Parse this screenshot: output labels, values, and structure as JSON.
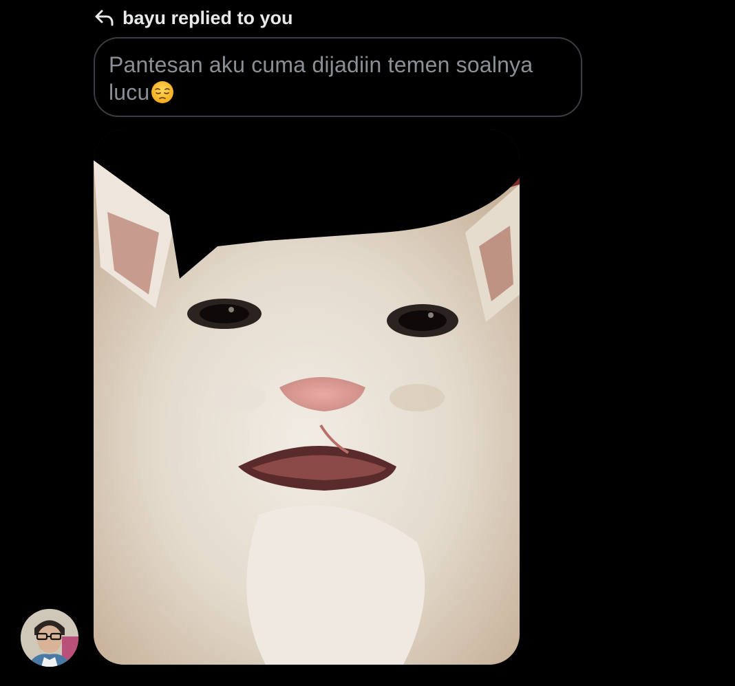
{
  "reply_header": {
    "icon": "reply-arrow-icon",
    "text": "bayu replied to you"
  },
  "quoted_message": {
    "text": "Pantesan aku cuma dijadiin temen soalnya lucu",
    "emoji": "pensive-face-emoji"
  },
  "media": {
    "kind": "image",
    "subject": "cat-meme-image"
  },
  "sender": {
    "avatar": "avatar"
  },
  "colors": {
    "background": "#000000",
    "header_text": "#e7e9ea",
    "quoted_text": "#8b9096",
    "bubble_border": "#3a3d41"
  }
}
